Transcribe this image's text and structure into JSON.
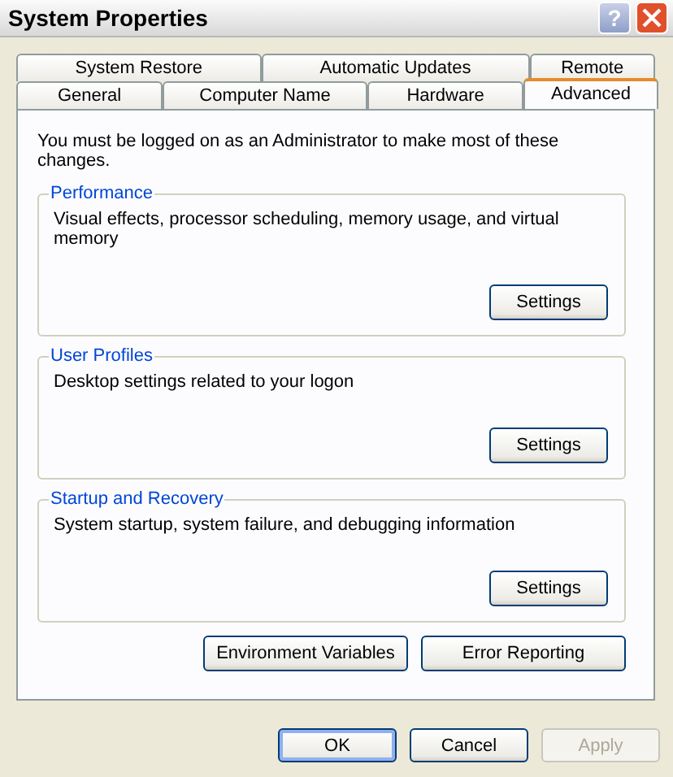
{
  "window": {
    "title": "System Properties",
    "help_label": "?"
  },
  "tab_rows": [
    [
      {
        "label": "System Restore",
        "selected": false
      },
      {
        "label": "Automatic Updates",
        "selected": false
      },
      {
        "label": "Remote",
        "selected": false
      }
    ],
    [
      {
        "label": "General",
        "selected": false
      },
      {
        "label": "Computer Name",
        "selected": false
      },
      {
        "label": "Hardware",
        "selected": false
      },
      {
        "label": "Advanced",
        "selected": true
      }
    ]
  ],
  "notice": "You must be logged on as an Administrator to make most of these changes.",
  "groups": [
    {
      "title": "Performance",
      "description": "Visual effects, processor scheduling, memory usage, and virtual memory",
      "button": "Settings"
    },
    {
      "title": "User Profiles",
      "description": "Desktop settings related to your logon",
      "button": "Settings"
    },
    {
      "title": "Startup and Recovery",
      "description": "System startup, system failure, and debugging information",
      "button": "Settings"
    }
  ],
  "panel_buttons": [
    "Environment Variables",
    "Error Reporting"
  ],
  "dialog_buttons": [
    {
      "label": "OK",
      "default": true,
      "disabled": false
    },
    {
      "label": "Cancel",
      "default": false,
      "disabled": false
    },
    {
      "label": "Apply",
      "default": false,
      "disabled": true
    }
  ]
}
